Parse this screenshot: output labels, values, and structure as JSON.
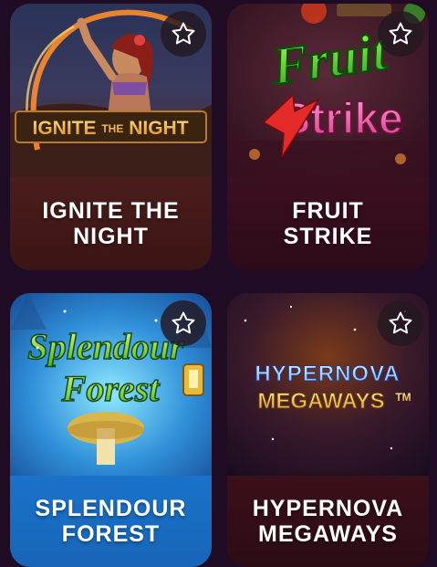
{
  "games": [
    {
      "id": "ignite-the-night",
      "title": "IGNITE THE NIGHT",
      "logo": [
        "IGNITE",
        "THE",
        "NIGHT"
      ],
      "favorite_icon": "star-outline-icon"
    },
    {
      "id": "fruit-strike",
      "title": "FRUIT STRIKE",
      "logo": [
        "Fruit",
        "Strike"
      ],
      "favorite_icon": "star-outline-icon"
    },
    {
      "id": "splendour-forest",
      "title": "SPLENDOUR FOREST",
      "logo": [
        "Splendour",
        "Forest"
      ],
      "favorite_icon": "star-outline-icon"
    },
    {
      "id": "hypernova-megaways",
      "title": "HYPERNOVA MEGAWAYS",
      "logo": [
        "HYPERNOVA",
        "MEGAWAYS",
        "TM"
      ],
      "favorite_icon": "star-outline-icon"
    }
  ],
  "colors": {
    "page_background": "#1f0c24",
    "favorite_button_background": "#231822",
    "caption_text": "#ffffff",
    "ignite_caption": "#4a1d1c",
    "fruit_caption": "#3b0f22",
    "splendour_caption": "#1a73c9",
    "hypernova_caption": "#3a1019"
  }
}
